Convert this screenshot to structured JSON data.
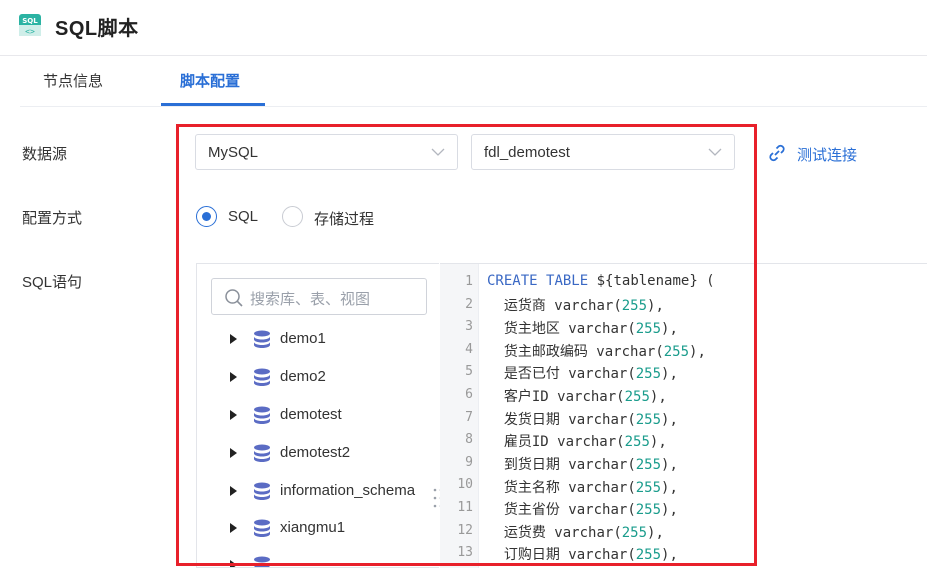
{
  "header": {
    "title": "SQL脚本",
    "icon": "sql-file-icon"
  },
  "tabs": [
    {
      "label": "节点信息"
    },
    {
      "label": "脚本配置",
      "active": true
    }
  ],
  "form": {
    "datasource_label": "数据源",
    "datasource_type": "MySQL",
    "datasource_db": "fdl_demotest",
    "test_connection": "测试连接",
    "config_label": "配置方式",
    "config_options": [
      {
        "label": "SQL",
        "selected": true
      },
      {
        "label": "存储过程",
        "selected": false
      }
    ],
    "sql_label": "SQL语句"
  },
  "tree": {
    "search_placeholder": "搜索库、表、视图",
    "items": [
      "demo1",
      "demo2",
      "demotest",
      "demotest2",
      "information_schema",
      "xiangmu1"
    ]
  },
  "editor": {
    "line_numbers": [
      "1",
      "2",
      "3",
      "4",
      "5",
      "6",
      "7",
      "8",
      "9",
      "10",
      "11",
      "12",
      "13"
    ],
    "header": {
      "kw1": "CREATE",
      "kw2": "TABLE",
      "rest": "${tablename} ("
    },
    "columns": [
      {
        "name": "运货商",
        "type": "varchar",
        "len": "255"
      },
      {
        "name": "货主地区",
        "type": "varchar",
        "len": "255"
      },
      {
        "name": "货主邮政编码",
        "type": "varchar",
        "len": "255"
      },
      {
        "name": "是否已付",
        "type": "varchar",
        "len": "255"
      },
      {
        "name": "客户ID",
        "type": "varchar",
        "len": "255"
      },
      {
        "name": "发货日期",
        "type": "varchar",
        "len": "255"
      },
      {
        "name": "雇员ID",
        "type": "varchar",
        "len": "255"
      },
      {
        "name": "到货日期",
        "type": "varchar",
        "len": "255"
      },
      {
        "name": "货主名称",
        "type": "varchar",
        "len": "255"
      },
      {
        "name": "货主省份",
        "type": "varchar",
        "len": "255"
      },
      {
        "name": "运货费",
        "type": "varchar",
        "len": "255"
      },
      {
        "name": "订购日期",
        "type": "varchar",
        "len": "255"
      }
    ]
  },
  "colors": {
    "accent": "#2a6fd6",
    "highlight": "#e8202a",
    "number": "#1a9c8c"
  }
}
